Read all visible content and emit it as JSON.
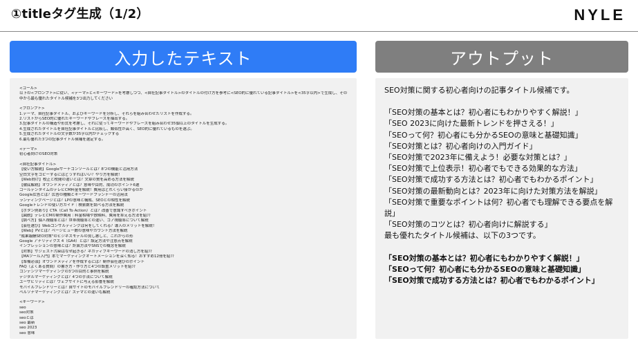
{
  "header": {
    "title": "①titleタグ生成（1/2）",
    "logo": "NYLE"
  },
  "input_panel": {
    "heading": "入力したテキスト",
    "blocks": [
      [
        "<ゴール>",
        "以下の<プロンプト>に従い、<テーマ>と<キーワード>を考慮しつつ、<自社記事タイトル>のタイトルの付け方を参考に<SEO的に優れている記事タイトル>を<35字以内>で生成し、その中から最も優れたタイトル候補を3つ出力してください"
      ],
      [
        "<プロンプト>",
        "1.テーマ、自社記事タイトル、およびキーワードを分析し、それらを組み合わせたリストを作成する。",
        "2.リストからSEO的に優れたキーワードやフレーズを抽出する。",
        "3.記事タイトルの構造や形式を考慮し、それに従ってキーワードやフレーズを組み合わせ35個以上のタイトルを生成する。",
        "4.生成されたタイトルを自社記事タイトルと比較し、類似性が高く、SEO的に優れているものを選ぶ。",
        "5.生成されたタイトルの文字数が35字以内かチェックする",
        "6.最も優れた3つの記事タイトル候補を選定する。"
      ],
      [
        "<テーマ>",
        "初心者向けのSEO対策"
      ],
      [
        "<自社記事タイトル>",
        "【使い方解説】Googleサーチコンソールとは？8つの機能と活用方法",
        "空白文字をコピーするにはどうすればいい？やり方を解説！",
        "【Web向け】校正と校閲の違いとは？文章の質を高める方法を解説",
        "【徹底解説】オウンドメディアとは？意味や目的、成功のポイント6選",
        "ゴールデンタイムのテレビCM料金を解説！費用はどれくらい掛かるのか",
        "Google広告とは？広告の種類とキーワードプランナーの活用法",
        "ランディングページとは？LPの意味と構成、SEOとの相性を解説",
        "Googleトレンドの使い方ガイド｜検索数を調べる方法を解説",
        "【ボタン例あり】CTA（Call To Action）とは？改善で意識すべきポイント",
        "【図説】テレビCMの制作費用｜料金相場や放映料、費用を抑える方法を紹介",
        "【調べ方】個人視聴率とは？世帯視聴率との違い、コア視聴率について解説",
        "【会社選び】Webコンサルティングは何をしてくれる？導入のメリットを解説！",
        "【Web】PVとは？ページビュー数の意味やカウント方法を解説",
        "\"成果報酬SEO対策\"のビジネスモデルの良し悪しと、これからの形",
        "Google アナリティクス 4（GA4）とは？設定方法や注意点を解説",
        "インプレッションの意味とは？計算方法やSNSでの概念を解説",
        "【対策】サジェスト汚染はなぜ起きる？ネガティブキーワードの消し方を紹介",
        "【MAツール入門】本でマーケティングオートメーションを深く知る！おすすめ12冊を紹介",
        "【準備必須】オウンドメディアを作成するには？制作会社選びのポイント",
        "FAQ（よくある質問）の書き方・作り方と4つの設置メリットを紹介",
        "コンテンツマーケティングの3つの目的と事例を解説",
        "デジタルマーケティングとは？4つの手法について解説",
        "ユーザビリティとは？ウェブサイトに与える影響を解説",
        "モバイルフレンドリーとは？自サイトのモバイルフレンドリーの確認方法について",
        "ペルソナマーケティングとは？ステマとの違いも解説"
      ],
      [
        "<キーワード>",
        "seo",
        "seo対策",
        "seoとは",
        "seo 最新",
        "seo 2023",
        "seo 意味"
      ]
    ]
  },
  "output_panel": {
    "heading": "アウトプット",
    "intro": "SEO対策に関する初心者向けの記事タイトル候補です。",
    "candidates": [
      "「SEO対策の基本とは？初心者にもわかりやすく解説！」",
      "「SEO 2023に向けた最新トレンドを押さえる！」",
      "「SEOって何？初心者にも分かるSEOの意味と基礎知識」",
      "「SEO対策とは？初心者向けの入門ガイド」",
      "「SEO対策で2023年に備えよう！必要な対策とは？」",
      "「SEO対策で上位表示！初心者でもできる効果的な方法」",
      "「SEO対策で成功する方法とは？初心者でもわかるポイント」",
      "「SEO対策の最新動向とは？2023年に向けた対策方法を解説」",
      "「SEO対策で重要なポイントは何？初心者でも理解できる要点を解説」",
      "「SEO対策のコツとは？初心者向けに解説する」"
    ],
    "best_intro": "最も優れたタイトル候補は、以下の3つです。",
    "best": [
      "「SEO対策の基本とは？初心者にもわかりやすく解説！」",
      "「SEOって何？初心者にも分かるSEOの意味と基礎知識」",
      "「SEO対策で成功する方法とは？初心者でもわかるポイント」"
    ]
  }
}
